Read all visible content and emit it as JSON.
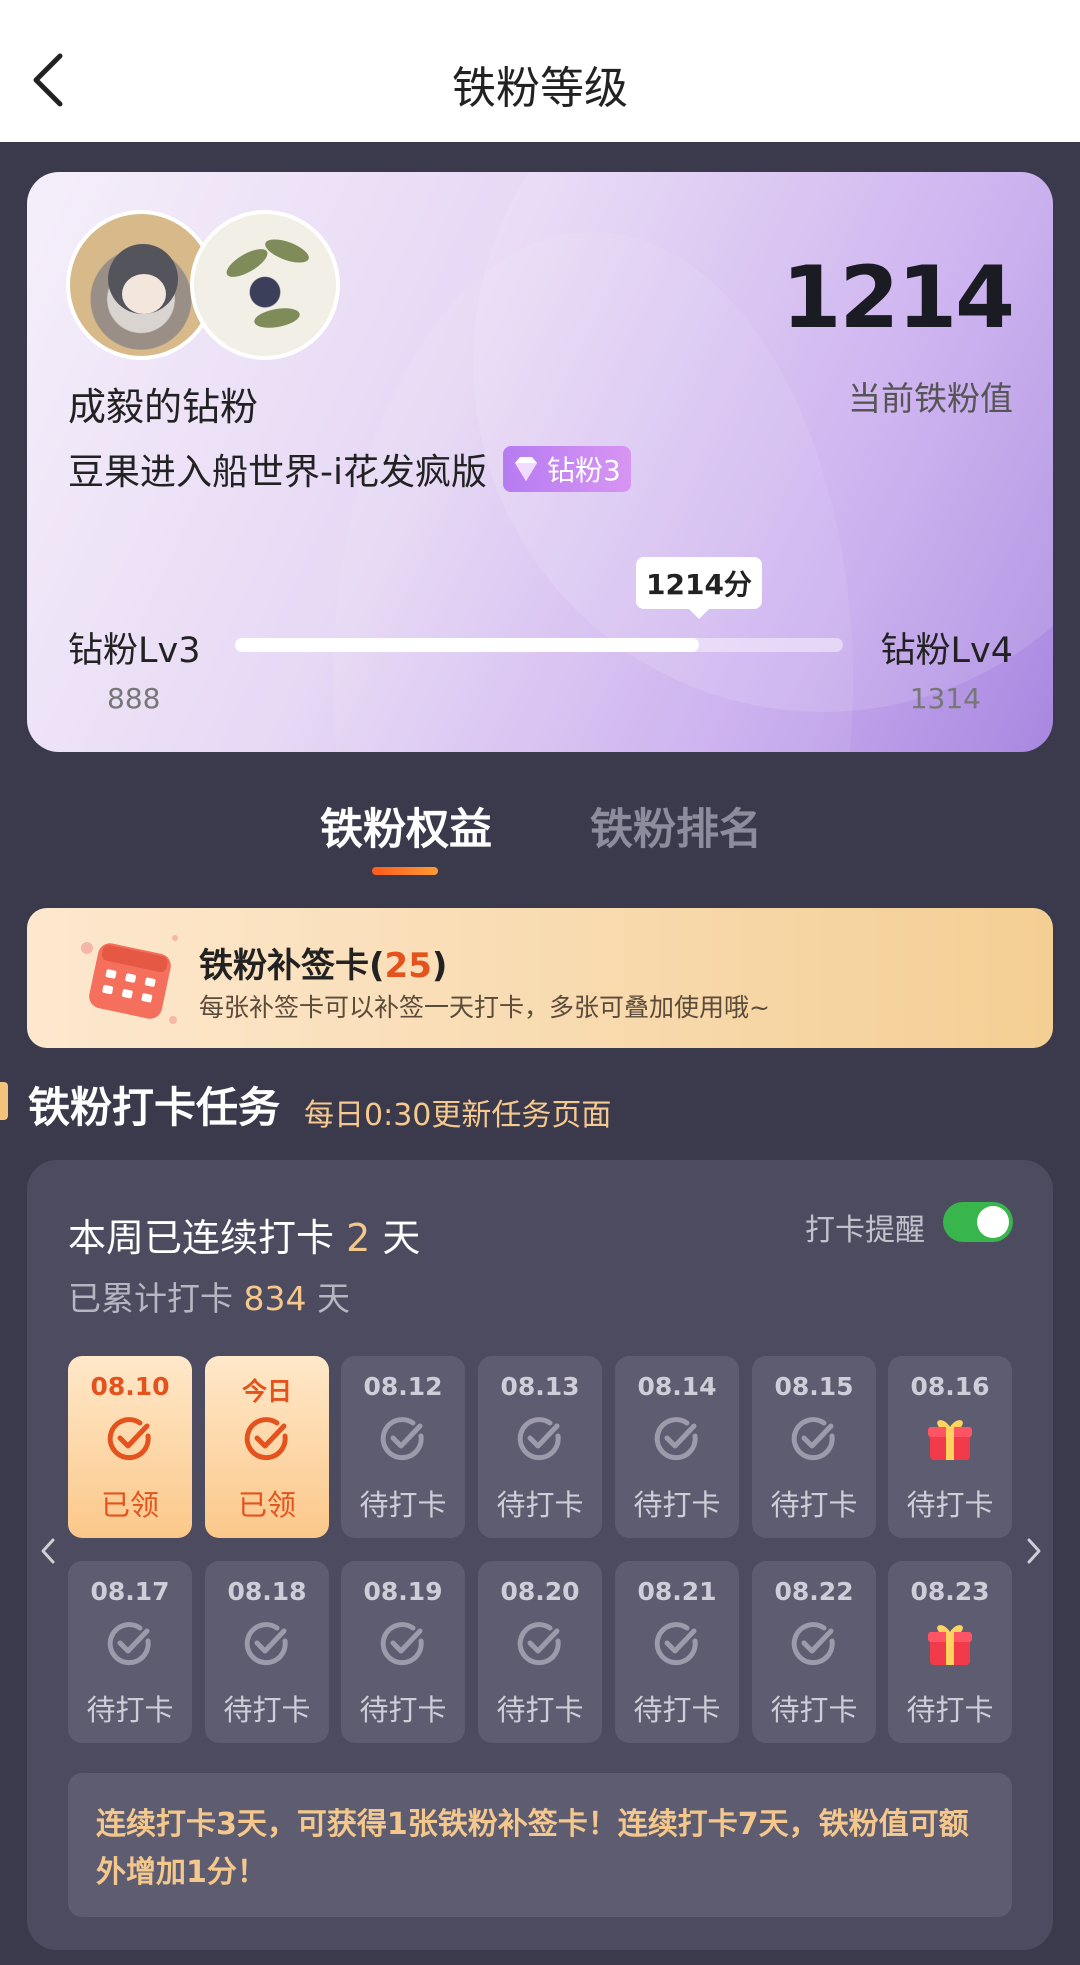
{
  "header": {
    "title": "铁粉等级"
  },
  "fan_card": {
    "name": "成毅的钻粉",
    "fandom": "豆果进入船世界-i花发疯版",
    "badge": "钻粉3",
    "score": "1214",
    "score_label": "当前铁粉值",
    "current_level": "钻粉Lv3",
    "current_level_points": "888",
    "next_level": "钻粉Lv4",
    "next_level_points": "1314",
    "progress_bubble": "1214分",
    "progress_fraction": 0.7635
  },
  "tabs": [
    {
      "label": "铁粉权益",
      "active": true
    },
    {
      "label": "铁粉排名",
      "active": false
    }
  ],
  "makeup_card": {
    "title": "铁粉补签卡",
    "count": "25",
    "description": "每张补签卡可以补签一天打卡，多张可叠加使用哦~"
  },
  "checkin_section": {
    "title": "铁粉打卡任务",
    "subtitle": "每日0:30更新任务页面",
    "streak_prefix": "本周已连续打卡",
    "streak_days": "2",
    "streak_suffix": "天",
    "total_prefix": "已累计打卡",
    "total_days": "834",
    "total_suffix": "天",
    "reminder_label": "打卡提醒",
    "reminder_on": true,
    "days": [
      {
        "date": "08.10",
        "status": "已领",
        "claimed": true,
        "icon": "check-circle-icon"
      },
      {
        "date": "今日",
        "status": "已领",
        "claimed": true,
        "icon": "check-circle-icon"
      },
      {
        "date": "08.12",
        "status": "待打卡",
        "claimed": false,
        "icon": "check-circle-icon"
      },
      {
        "date": "08.13",
        "status": "待打卡",
        "claimed": false,
        "icon": "check-circle-icon"
      },
      {
        "date": "08.14",
        "status": "待打卡",
        "claimed": false,
        "icon": "check-circle-icon"
      },
      {
        "date": "08.15",
        "status": "待打卡",
        "claimed": false,
        "icon": "check-circle-icon"
      },
      {
        "date": "08.16",
        "status": "待打卡",
        "claimed": false,
        "icon": "gift-icon"
      },
      {
        "date": "08.17",
        "status": "待打卡",
        "claimed": false,
        "icon": "check-circle-icon"
      },
      {
        "date": "08.18",
        "status": "待打卡",
        "claimed": false,
        "icon": "check-circle-icon"
      },
      {
        "date": "08.19",
        "status": "待打卡",
        "claimed": false,
        "icon": "check-circle-icon"
      },
      {
        "date": "08.20",
        "status": "待打卡",
        "claimed": false,
        "icon": "check-circle-icon"
      },
      {
        "date": "08.21",
        "status": "待打卡",
        "claimed": false,
        "icon": "check-circle-icon"
      },
      {
        "date": "08.22",
        "status": "待打卡",
        "claimed": false,
        "icon": "check-circle-icon"
      },
      {
        "date": "08.23",
        "status": "待打卡",
        "claimed": false,
        "icon": "gift-icon"
      }
    ],
    "tip": "连续打卡3天，可获得1张铁粉补签卡！连续打卡7天，铁粉值可额外增加1分！"
  },
  "colors": {
    "page_bg": "#3b3a4c",
    "card_bg": "#4d4b5f",
    "accent_orange": "#e4521e",
    "accent_gold": "#f4c78c",
    "toggle_on": "#38b64b"
  }
}
